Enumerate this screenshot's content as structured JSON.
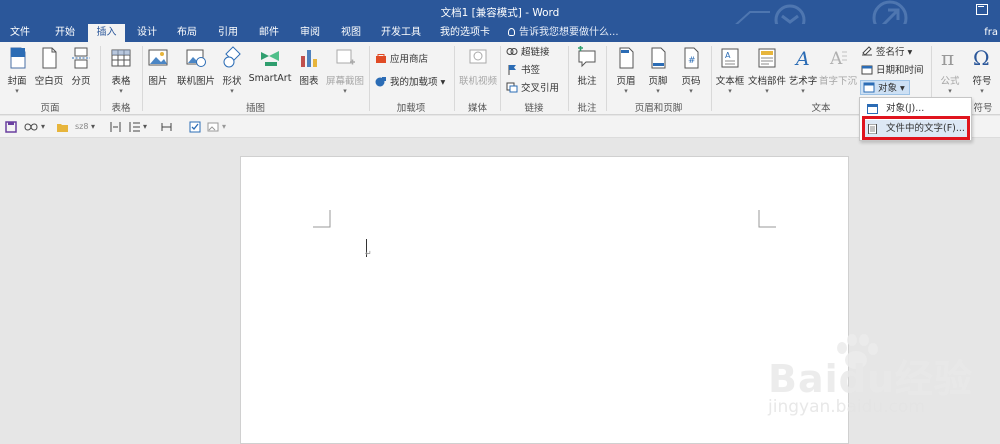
{
  "window": {
    "title": "文档1 [兼容模式] - Word",
    "user": "fra"
  },
  "tabs": [
    {
      "label": "文件",
      "active": false
    },
    {
      "label": "开始",
      "active": false
    },
    {
      "label": "插入",
      "active": true
    },
    {
      "label": "设计",
      "active": false
    },
    {
      "label": "布局",
      "active": false
    },
    {
      "label": "引用",
      "active": false
    },
    {
      "label": "邮件",
      "active": false
    },
    {
      "label": "审阅",
      "active": false
    },
    {
      "label": "视图",
      "active": false
    },
    {
      "label": "开发工具",
      "active": false
    },
    {
      "label": "我的选项卡",
      "active": false
    }
  ],
  "tell_me": "告诉我您想要做什么...",
  "ribbon": {
    "pages": {
      "label": "页面",
      "cover": "封面",
      "blank": "空白页",
      "break": "分页"
    },
    "tables": {
      "label": "表格",
      "table": "表格"
    },
    "illustrations": {
      "label": "插图",
      "picture": "图片",
      "online_picture": "联机图片",
      "shapes": "形状",
      "smartart": "SmartArt",
      "chart": "图表",
      "screenshot": "屏幕截图"
    },
    "addins": {
      "label": "加载项",
      "store": "应用商店",
      "my_addins": "我的加载项"
    },
    "media": {
      "label": "媒体",
      "online_video": "联机视频"
    },
    "links": {
      "label": "链接",
      "hyperlink": "超链接",
      "bookmark": "书签",
      "cross_ref": "交叉引用"
    },
    "comments": {
      "label": "批注",
      "comment": "批注"
    },
    "header_footer": {
      "label": "页眉和页脚",
      "header": "页眉",
      "footer": "页脚",
      "page_number": "页码"
    },
    "text": {
      "label": "文本",
      "text_box": "文本框",
      "quick_parts": "文档部件",
      "wordart": "艺术字",
      "drop_cap": "首字下沉",
      "signature_line": "签名行",
      "date_time": "日期和时间",
      "object": "对象"
    },
    "symbols": {
      "label": "符号",
      "equation": "公式",
      "symbol": "符号"
    }
  },
  "qat": {
    "font_sample": "sz8"
  },
  "object_menu": {
    "items": [
      {
        "label": "对象(J)...",
        "icon": "object-icon"
      },
      {
        "label": "文件中的文字(F)...",
        "icon": "text-file-icon"
      }
    ],
    "highlight_color": "#e0141e"
  },
  "document": {
    "paragraph_mark": "↵"
  },
  "watermark": {
    "line1": "Baidu经验",
    "line2": "jingyan.baidu.com"
  },
  "colors": {
    "accent": "#2b579a",
    "ribbon_bg": "#f3f3f3",
    "canvas": "#e6e6e6",
    "highlight": "#e0141e"
  }
}
